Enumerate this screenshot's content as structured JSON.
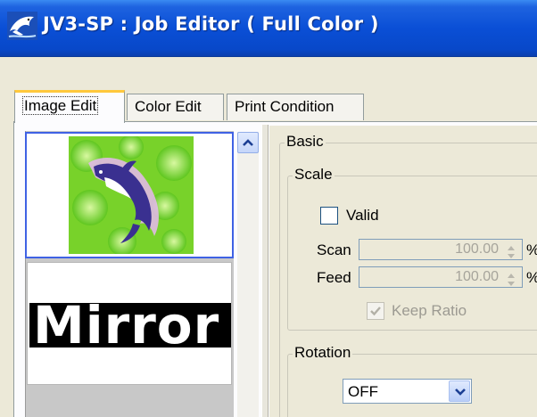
{
  "window": {
    "title": "JV3-SP : Job Editor ( Full Color )",
    "icon": "dolphin-app-icon"
  },
  "tabs": [
    {
      "label": "Image Edit",
      "active": true
    },
    {
      "label": "Color Edit",
      "active": false
    },
    {
      "label": "Print Condition",
      "active": false
    }
  ],
  "thumbnails": [
    {
      "name": "dolphin-image",
      "selected": true
    },
    {
      "name": "mirror-image",
      "text": "Mirror",
      "selected": false
    }
  ],
  "basic": {
    "legend": "Basic",
    "scale": {
      "legend": "Scale",
      "valid_label": "Valid",
      "valid_checked": false,
      "scan_label": "Scan",
      "scan_value": "100.00",
      "scan_unit": "%",
      "feed_label": "Feed",
      "feed_value": "100.00",
      "feed_unit": "%",
      "keep_ratio_label": "Keep Ratio",
      "keep_ratio_checked": true
    },
    "rotation": {
      "legend": "Rotation",
      "selected": "OFF"
    }
  },
  "colors": {
    "titlebar": "#0a4fd6",
    "tab_highlight": "#ffc83c",
    "selection_border": "#3f62e4"
  }
}
